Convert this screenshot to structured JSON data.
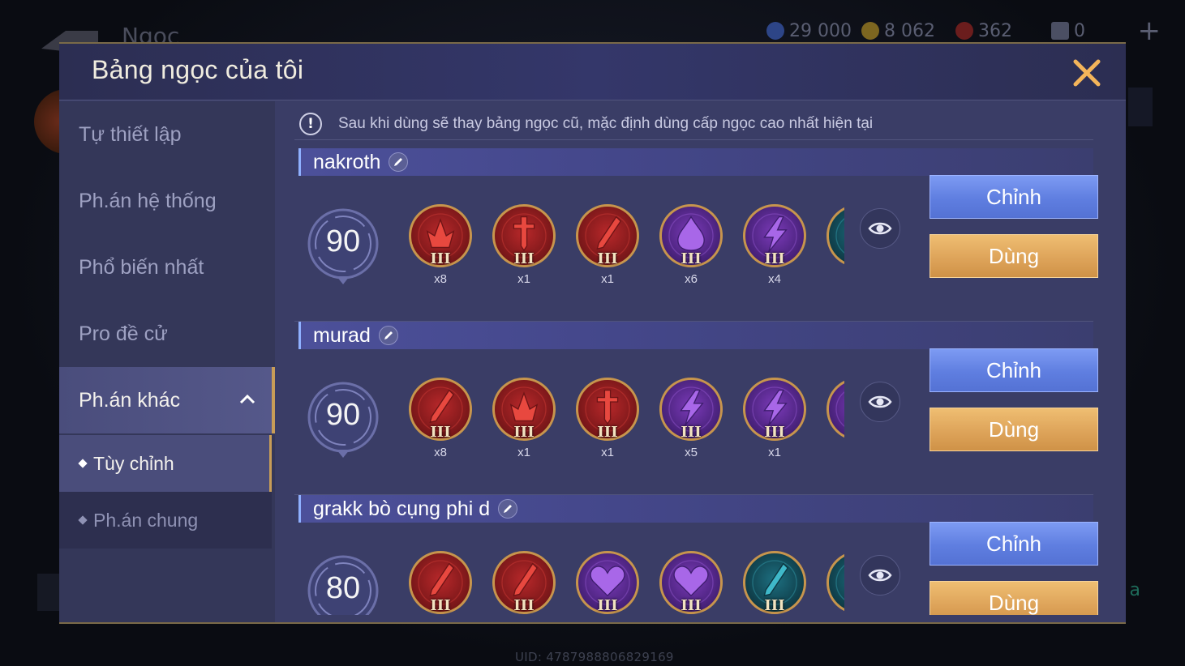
{
  "background": {
    "title": "Ngọc",
    "resources": [
      {
        "icon": "blue-coin-icon",
        "value": "29 000",
        "color": "#3d5fb0"
      },
      {
        "icon": "gold-coin-icon",
        "value": "8 062",
        "color": "#a5842a"
      },
      {
        "icon": "red-gem-icon",
        "value": "362",
        "color": "#9b2a2a"
      },
      {
        "icon": "ticket-icon",
        "value": "0",
        "color": "#6a6f86"
      }
    ],
    "uid": "UID: 4787988806829169"
  },
  "modal": {
    "title": "Bảng ngọc của tôi",
    "notice": "Sau khi dùng sẽ thay bảng ngọc cũ, mặc định dùng cấp ngọc cao nhất hiện tại"
  },
  "sidebar": {
    "items": [
      {
        "label": "Tự thiết lập"
      },
      {
        "label": "Ph.án hệ thống"
      },
      {
        "label": "Phổ biến nhất"
      },
      {
        "label": "Pro đề cử"
      },
      {
        "label": "Ph.án khác"
      }
    ],
    "subitems": [
      {
        "label": "Tùy chỉnh"
      },
      {
        "label": "Ph.án chung"
      }
    ]
  },
  "presets": [
    {
      "name": "nakroth",
      "level": "90",
      "gems": [
        {
          "color": "red",
          "symbol": "spike",
          "tier": "III",
          "count": "x8"
        },
        {
          "color": "red",
          "symbol": "sword",
          "tier": "III",
          "count": "x1"
        },
        {
          "color": "red",
          "symbol": "blade",
          "tier": "III",
          "count": "x1"
        },
        {
          "color": "purple",
          "symbol": "drop",
          "tier": "III",
          "count": "x6"
        },
        {
          "color": "purple",
          "symbol": "bolt",
          "tier": "III",
          "count": "x4"
        },
        {
          "color": "teal",
          "symbol": "blade",
          "tier": "",
          "count": ""
        }
      ],
      "edit_label": "Chỉnh",
      "use_label": "Dùng"
    },
    {
      "name": "murad",
      "level": "90",
      "gems": [
        {
          "color": "red",
          "symbol": "blade",
          "tier": "III",
          "count": "x8"
        },
        {
          "color": "red",
          "symbol": "spike",
          "tier": "III",
          "count": "x1"
        },
        {
          "color": "red",
          "symbol": "sword",
          "tier": "III",
          "count": "x1"
        },
        {
          "color": "purple",
          "symbol": "bolt",
          "tier": "III",
          "count": "x5"
        },
        {
          "color": "purple",
          "symbol": "bolt",
          "tier": "III",
          "count": "x1"
        },
        {
          "color": "purple",
          "symbol": "bolt",
          "tier": "",
          "count": ""
        }
      ],
      "edit_label": "Chỉnh",
      "use_label": "Dùng"
    },
    {
      "name": "grakk bò cụng phi d",
      "level": "80",
      "gems": [
        {
          "color": "red",
          "symbol": "blade",
          "tier": "III",
          "count": ""
        },
        {
          "color": "red",
          "symbol": "blade",
          "tier": "III",
          "count": ""
        },
        {
          "color": "purple",
          "symbol": "heart",
          "tier": "III",
          "count": ""
        },
        {
          "color": "purple",
          "symbol": "heart",
          "tier": "III",
          "count": ""
        },
        {
          "color": "teal",
          "symbol": "blade",
          "tier": "III",
          "count": ""
        },
        {
          "color": "teal",
          "symbol": "blade",
          "tier": "",
          "count": ""
        }
      ],
      "edit_label": "Chỉnh",
      "use_label": "Dùng"
    }
  ]
}
